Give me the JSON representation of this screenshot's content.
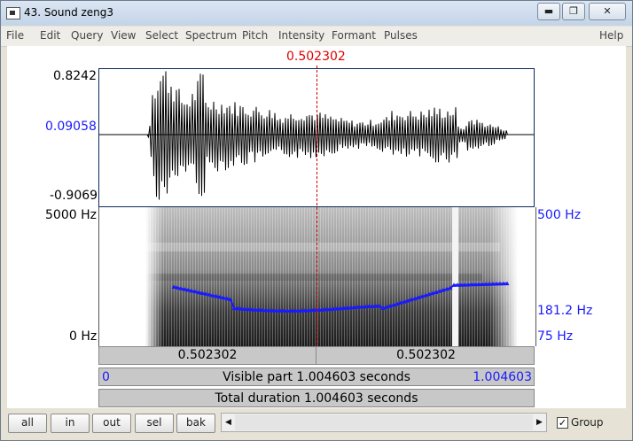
{
  "window": {
    "title": "43. Sound zeng3",
    "controls": [
      "minimize",
      "restore",
      "close"
    ]
  },
  "menu": {
    "items": [
      "File",
      "Edit",
      "Query",
      "View",
      "Select",
      "Spectrum",
      "Pitch",
      "Intensity",
      "Formant",
      "Pulses"
    ],
    "help": "Help"
  },
  "waveform": {
    "cursor_time": "0.502302",
    "y_max": "0.8242",
    "y_zero": "0.09058",
    "y_min": "-0.9069"
  },
  "spectrogram": {
    "freq_max": "5000 Hz",
    "freq_min": "0 Hz",
    "pitch_max": "500 Hz",
    "pitch_current": "181.2 Hz",
    "pitch_min": "75 Hz"
  },
  "time_bars": {
    "left_part": "0.502302",
    "right_part": "0.502302",
    "visible_start": "0",
    "visible_label": "Visible part 1.004603 seconds",
    "visible_end": "1.004603",
    "total_label": "Total duration 1.004603 seconds"
  },
  "controls": {
    "all": "all",
    "in": "in",
    "out": "out",
    "sel": "sel",
    "bak": "bak",
    "group_label": "Group",
    "group_checked": true
  },
  "colors": {
    "cursor": "#e00000",
    "pitch_track": "#1a1aff",
    "axis_blue": "#1a1aff"
  }
}
